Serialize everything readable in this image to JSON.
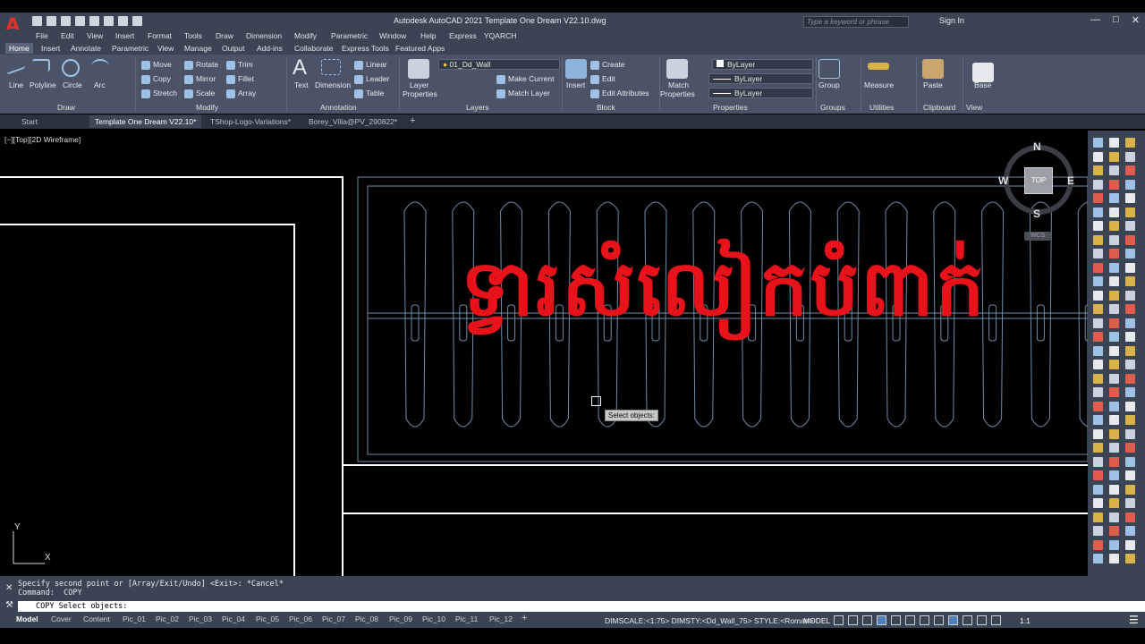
{
  "app": {
    "title": "Autodesk AutoCAD 2021   Template One Dream V22.10.dwg",
    "search_placeholder": "Type a keyword or phrase",
    "sign_in": "Sign In",
    "logo_letter": "A"
  },
  "menu": [
    "File",
    "Edit",
    "View",
    "Insert",
    "Format",
    "Tools",
    "Draw",
    "Dimension",
    "Modify",
    "Parametric",
    "Window",
    "Help",
    "Express",
    "YQARCH"
  ],
  "ribbon_tabs": [
    "Home",
    "Insert",
    "Annotate",
    "Parametric",
    "View",
    "Manage",
    "Output",
    "Add-ins",
    "Collaborate",
    "Express Tools",
    "Featured Apps"
  ],
  "ribbon": {
    "draw": {
      "title": "Draw",
      "line": "Line",
      "polyline": "Polyline",
      "circle": "Circle",
      "arc": "Arc"
    },
    "modify": {
      "title": "Modify",
      "move": "Move",
      "rotate": "Rotate",
      "trim": "Trim",
      "copy": "Copy",
      "mirror": "Mirror",
      "fillet": "Fillet",
      "stretch": "Stretch",
      "scale": "Scale",
      "array": "Array"
    },
    "annotation": {
      "title": "Annotation",
      "text": "Text",
      "dimension": "Dimension",
      "linear": "Linear",
      "leader": "Leader",
      "table": "Table"
    },
    "layers": {
      "title": "Layers",
      "layer_properties_1": "Layer",
      "layer_properties_2": "Properties",
      "current_layer": "01_Dd_Wall",
      "make_current": "Make Current",
      "match_layer": "Match Layer"
    },
    "block": {
      "title": "Block",
      "insert": "Insert",
      "create": "Create",
      "edit": "Edit",
      "edit_attributes": "Edit Attributes"
    },
    "properties": {
      "title": "Properties",
      "match_1": "Match",
      "match_2": "Properties",
      "color": "ByLayer",
      "linetype": "ByLayer",
      "lineweight": "ByLayer"
    },
    "groups": {
      "title": "Groups",
      "group": "Group"
    },
    "utilities": {
      "title": "Utilities",
      "measure": "Measure"
    },
    "clipboard": {
      "title": "Clipboard",
      "paste": "Paste"
    },
    "view": {
      "title": "View",
      "base": "Base"
    }
  },
  "doc_tabs": [
    "Start",
    "Template One Dream V22.10*",
    "TShop-Logo-Variations*",
    "Borey_Villa@PV_290822*"
  ],
  "viewport": {
    "label": "[−][Top][2D Wireframe]",
    "overlay_text": "ទ្វារសំលៀកបំពាក់",
    "tooltip": "Select objects:",
    "compass": {
      "n": "N",
      "s": "S",
      "e": "E",
      "w": "W",
      "top": "TOP",
      "wcs": "WCS"
    },
    "ucs": {
      "x": "X",
      "y": "Y"
    }
  },
  "command": {
    "history_1": "Specify second point or [Array/Exit/Undo] <Exit>: *Cancel*",
    "history_2": "Command:  COPY",
    "input": "COPY Select objects:"
  },
  "layout_tabs": [
    "Model",
    "Cover",
    "Content",
    "Pic_01",
    "Pic_02",
    "Pic_03",
    "Pic_04",
    "Pic_05",
    "Pic_06",
    "Pic_07",
    "Pic_08",
    "Pic_09",
    "Pic_10",
    "Pic_11",
    "Pic_12"
  ],
  "status": {
    "info": "DIMSCALE:<1:75> DIMSTY:<Dd_Wall_75> STYLE:<Roman>",
    "mode": "MODEL",
    "scale": "1:1"
  },
  "colors": {
    "accent_red": "#e8121a",
    "ribbon": "#4a5466",
    "chrome": "#3b4453"
  }
}
